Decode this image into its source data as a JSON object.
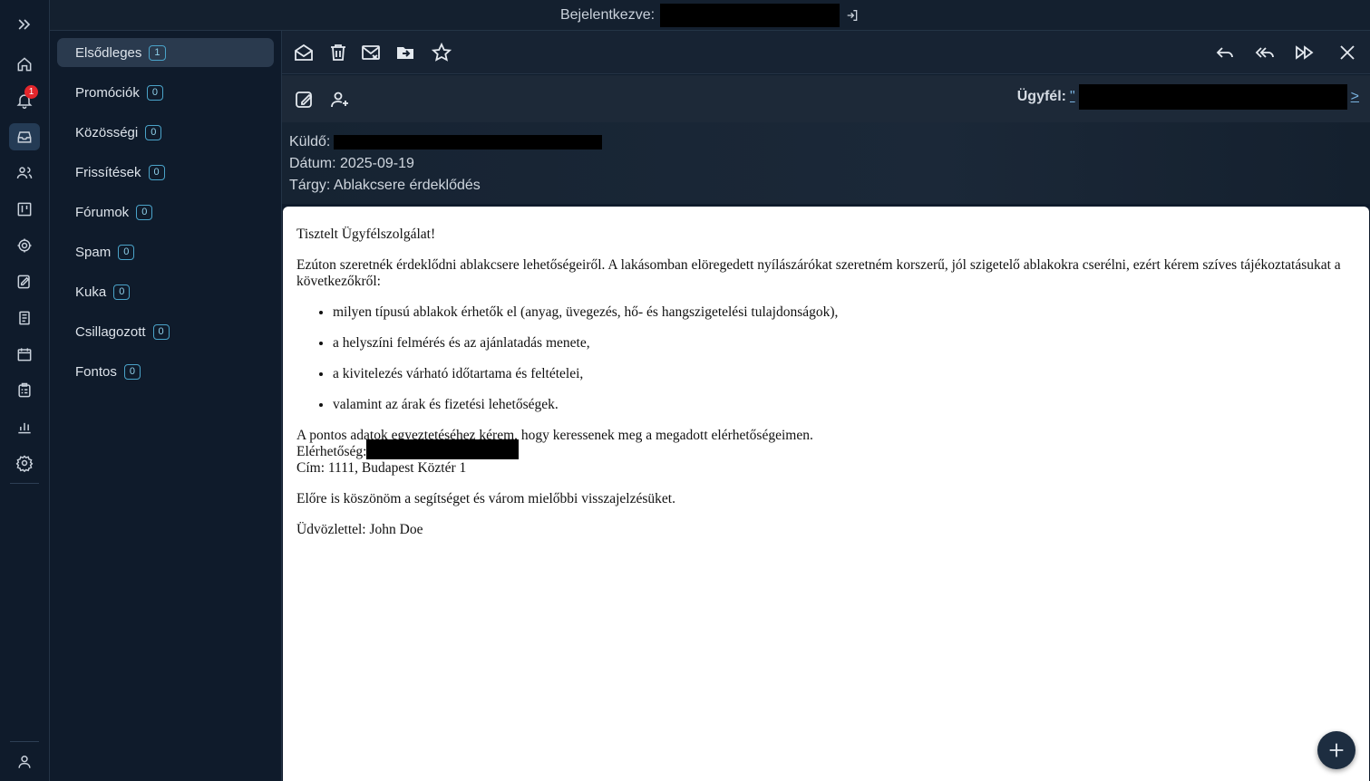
{
  "topbar": {
    "logged_in_label": "Bejelentkezve:"
  },
  "folders": [
    {
      "name": "Elsődleges",
      "count": "1"
    },
    {
      "name": "Promóciók",
      "count": "0"
    },
    {
      "name": "Közösségi",
      "count": "0"
    },
    {
      "name": "Frissítések",
      "count": "0"
    },
    {
      "name": "Fórumok",
      "count": "0"
    },
    {
      "name": "Spam",
      "count": "0"
    },
    {
      "name": "Kuka",
      "count": "0"
    },
    {
      "name": "Csillagozott",
      "count": "0"
    },
    {
      "name": "Fontos",
      "count": "0"
    }
  ],
  "rail": {
    "notification_count": "1"
  },
  "client": {
    "label": "Ügyfél:",
    "quote": "\"",
    "suffix": ">"
  },
  "email": {
    "sender_label": "Küldő:",
    "date": "Dátum: 2025-09-19",
    "subject": "Tárgy: Ablakcsere érdeklődés",
    "greeting": "Tisztelt Ügyfélszolgálat!",
    "intro": "Ezúton szeretnék érdeklődni ablakcsere lehetőségeiről. A lakásomban elöregedett nyílászárókat szeretném korszerű, jól szigetelő ablakokra cserélni, ezért kérem szíves tájékoztatásukat a következőkről:",
    "bullets": [
      "milyen típusú ablakok érhetők el (anyag, üvegezés, hő- és hangszigetelési tulajdonságok),",
      "a helyszíni felmérés és az ajánlatadás menete,",
      "a kivitelezés várható időtartama és feltételei,",
      "valamint az árak és fizetési lehetőségek."
    ],
    "contact_line": "A pontos adatok egyeztetéséhez kérem, hogy keressenek meg a megadott elérhetőségeimen.",
    "contact_label": "Elérhetőség:",
    "address": "Cím: 1111, Budapest Köztér 1",
    "thanks": "Előre is köszönöm a segítséget és várom mielőbbi visszajelzésüket.",
    "signoff": "Üdvözlettel: John Doe"
  }
}
